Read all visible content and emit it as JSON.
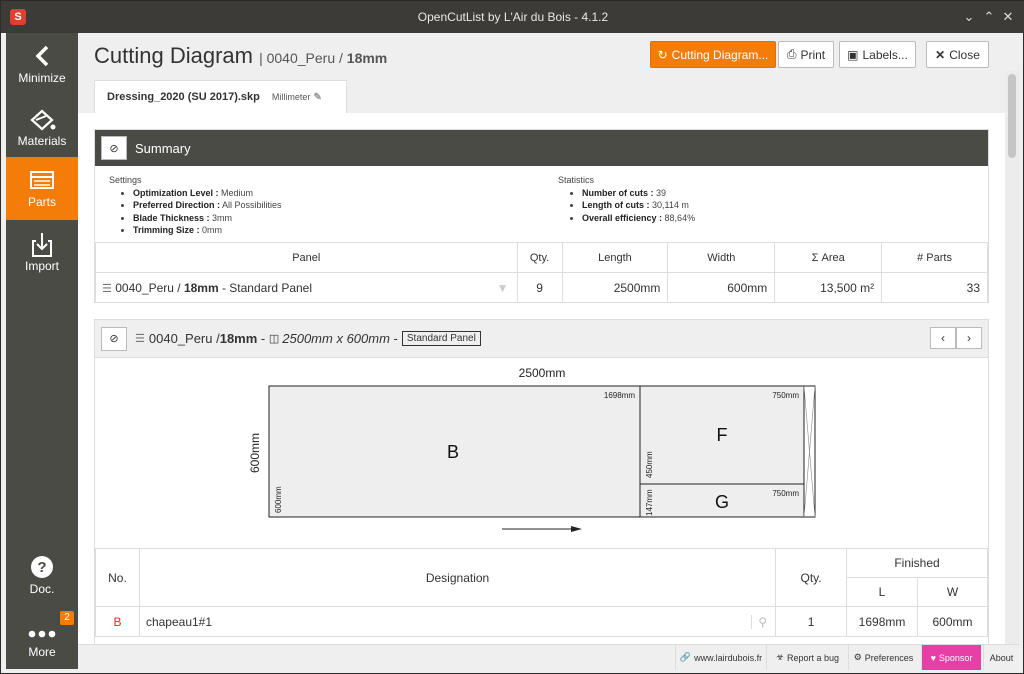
{
  "window": {
    "title": "OpenCutList by L'Air du Bois - 4.1.2"
  },
  "sidebar": {
    "items": [
      {
        "label": "Minimize",
        "icon": "chevron-left-icon"
      },
      {
        "label": "Materials",
        "icon": "materials-icon"
      },
      {
        "label": "Parts",
        "icon": "parts-list-icon",
        "active": true
      },
      {
        "label": "Import",
        "icon": "import-icon"
      },
      {
        "label": "Doc.",
        "icon": "question-icon"
      },
      {
        "label": "More",
        "icon": "more-dots-icon",
        "badge": "2"
      }
    ]
  },
  "header": {
    "title": "Cutting Diagram",
    "sub_prefix": "| 0040_Peru / ",
    "sub_thickness": "18mm",
    "buttons": {
      "cutting_diagram": "Cutting Diagram...",
      "print": "Print",
      "labels": "Labels...",
      "close": "Close"
    }
  },
  "tab": {
    "filename": "Dressing_2020 (SU 2017).skp",
    "unit": "Millimeter"
  },
  "summary": {
    "title": "Summary",
    "settings_heading": "Settings",
    "settings": [
      {
        "k": "Optimization Level :",
        "v": " Medium"
      },
      {
        "k": "Preferred Direction :",
        "v": " All Possibilities"
      },
      {
        "k": "Blade Thickness :",
        "v": " 3mm"
      },
      {
        "k": "Trimming Size :",
        "v": " 0mm"
      }
    ],
    "stats_heading": "Statistics",
    "stats": [
      {
        "k": "Number of cuts :",
        "v": " 39"
      },
      {
        "k": "Length of cuts :",
        "v": " 30,114 m"
      },
      {
        "k": "Overall efficiency :",
        "v": " 88,64%"
      }
    ],
    "table": {
      "headers": [
        "Panel",
        "Qty.",
        "Length",
        "Width",
        "Σ Area",
        "# Parts"
      ],
      "row": {
        "material": "0040_Peru / ",
        "thickness": "18mm",
        "type": " - Standard Panel",
        "qty": "9",
        "length": "2500mm",
        "width": "600mm",
        "area": "13,500 m²",
        "parts": "33"
      }
    }
  },
  "diagram": {
    "material": "0040_Peru / ",
    "thickness": "18mm",
    "sep": " - ",
    "size": "2500mm x 600mm",
    "sep2": " -",
    "panel_type": "Standard Panel",
    "dims": {
      "length": "2500mm",
      "width": "600mm"
    },
    "parts": [
      {
        "label": "B",
        "length": "1698mm",
        "width": "600mm"
      },
      {
        "label": "F",
        "length": "750mm",
        "width": "450mm"
      },
      {
        "label": "G",
        "length": "750mm",
        "width": "147mm"
      }
    ]
  },
  "parts_table": {
    "headers": {
      "no": "No.",
      "designation": "Designation",
      "qty": "Qty.",
      "finished": "Finished",
      "l": "L",
      "w": "W"
    },
    "rows": [
      {
        "no": "B",
        "designation": "chapeau1#1",
        "qty": "1",
        "l": "1698mm",
        "w": "600mm"
      }
    ]
  },
  "footer": {
    "website": "www.lairdubois.fr",
    "bug": "Report a bug",
    "prefs": "Preferences",
    "sponsor": "Sponsor",
    "about": "About"
  },
  "colors": {
    "accent": "#f47d0a",
    "sidebar": "#4b4b46",
    "sponsor": "#e73fa6",
    "part_label": "#d9342b"
  }
}
